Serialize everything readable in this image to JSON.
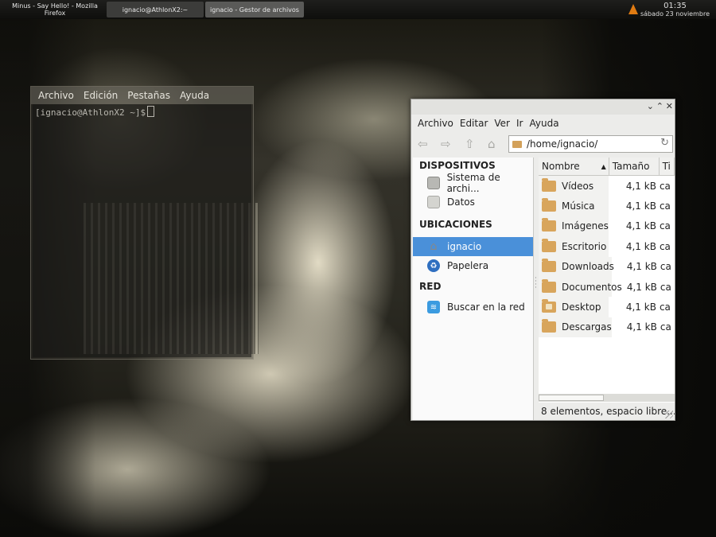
{
  "panel": {
    "tasks": [
      {
        "label": "Minus - Say Hello! - Mozilla Firefox"
      },
      {
        "label": "ignacio@AthlonX2:~"
      },
      {
        "label": "ignacio - Gestor de archivos"
      }
    ],
    "tray_icon": "vlc-icon",
    "clock": {
      "time": "01:35",
      "date": "sábado 23 noviembre"
    }
  },
  "terminal": {
    "menu": [
      "Archivo",
      "Edición",
      "Pestañas",
      "Ayuda"
    ],
    "prompt": "[ignacio@AthlonX2 ~]$"
  },
  "file_manager": {
    "menu": [
      "Archivo",
      "Editar",
      "Ver",
      "Ir",
      "Ayuda"
    ],
    "location": "/home/ignacio/",
    "sidebar": {
      "sections": [
        {
          "title": "DISPOSITIVOS",
          "items": [
            {
              "label": "Sistema de archi...",
              "icon": "drive-icon"
            },
            {
              "label": "Datos",
              "icon": "drive-icon"
            }
          ]
        },
        {
          "title": "UBICACIONES",
          "items": [
            {
              "label": "ignacio",
              "icon": "home-icon"
            },
            {
              "label": "Papelera",
              "icon": "trash-icon"
            }
          ]
        },
        {
          "title": "RED",
          "items": [
            {
              "label": "Buscar en la red",
              "icon": "network-icon"
            }
          ]
        }
      ]
    },
    "columns": {
      "name": "Nombre",
      "size": "Tamaño",
      "type": "Ti"
    },
    "files": [
      {
        "name": "Vídeos",
        "size": "4,1 kB",
        "type": "ca"
      },
      {
        "name": "Música",
        "size": "4,1 kB",
        "type": "ca"
      },
      {
        "name": "Imágenes",
        "size": "4,1 kB",
        "type": "ca"
      },
      {
        "name": "Escritorio",
        "size": "4,1 kB",
        "type": "ca"
      },
      {
        "name": "Downloads",
        "size": "4,1 kB",
        "type": "ca"
      },
      {
        "name": "Documentos",
        "size": "4,1 kB",
        "type": "ca"
      },
      {
        "name": "Desktop",
        "size": "4,1 kB",
        "type": "ca"
      },
      {
        "name": "Descargas",
        "size": "4,1 kB",
        "type": "ca"
      }
    ],
    "status": "8 elementos, espacio libre..."
  }
}
